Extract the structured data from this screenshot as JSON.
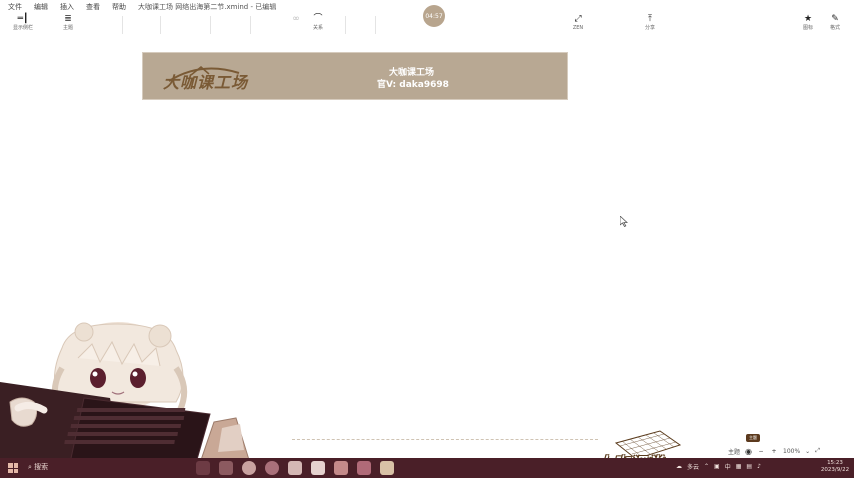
{
  "menu": {
    "items": [
      "文件",
      "编辑",
      "插入",
      "查看",
      "帮助"
    ],
    "document_title": "大咖课工场 网络出海第二节.xmind - 已编辑"
  },
  "timer": "04:57",
  "toolbar": {
    "left": [
      {
        "label": "显示侧栏",
        "icon": "sidebar-icon"
      },
      {
        "label": "主题",
        "icon": "topic-icon"
      }
    ],
    "middle": [
      {
        "label": "关系",
        "icon": "relation-icon"
      }
    ],
    "right": [
      {
        "label": "ZEN",
        "icon": "zen-icon"
      },
      {
        "label": "分享",
        "icon": "share-icon"
      },
      {
        "label": "图标",
        "icon": "star-icon"
      },
      {
        "label": "格式",
        "icon": "format-icon"
      }
    ]
  },
  "banner": {
    "logo_text": "大咖课工场",
    "line1": "大咖课工场",
    "line2": "官V: daka9698",
    "background": "#b8a893"
  },
  "stamp": {
    "text": "大咖课堂"
  },
  "status": {
    "tooltip": "主题",
    "zoom": "100%",
    "topic_label": "主题",
    "minus": "−",
    "plus": "+"
  },
  "taskbar": {
    "search": "搜索",
    "weather": "多云",
    "lang": "中",
    "time": "15:23",
    "date": "2023/9/22"
  },
  "colors": {
    "accent": "#b8a893",
    "taskbar": "#4a1f28",
    "stamp_brown": "#5a3b1c"
  }
}
